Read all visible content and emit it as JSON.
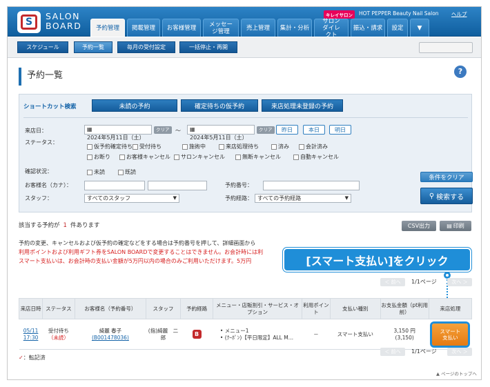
{
  "header": {
    "brand_line1": "SALON",
    "brand_line2": "BOARD",
    "logo_letter": "S",
    "kirei_badge": "キレイサロン",
    "salon_name": "HOT PEPPER Beauty Nail Salon",
    "help_link": "ヘルプ"
  },
  "nav": [
    "予約管理",
    "掲載管理",
    "お客様管理",
    "メッセージ管理",
    "売上管理",
    "集計・分析",
    "サロンダイレクト",
    "振込・請求",
    "設定"
  ],
  "subnav": [
    "スケジュール",
    "予約一覧",
    "毎月の受付設定",
    "一括停止・再開"
  ],
  "page_title": "予約一覧",
  "help_icon": "?",
  "shortcut": {
    "label": "ショートカット検索",
    "buttons": [
      "未読の予約",
      "確定待ちの仮予約",
      "来店処理未登録の予約"
    ]
  },
  "form": {
    "visit_date_label": "来店日：",
    "date_from": "2024年5月11日（土）",
    "date_to": "2024年5月11日（土）",
    "clear": "クリア",
    "tilde": "〜",
    "day_buttons": [
      "昨日",
      "本日",
      "明日"
    ],
    "status_label": "ステータス：",
    "statuses": [
      "仮予約確定待ち",
      "受付待ち",
      "施術中",
      "来店処理待ち",
      "済み",
      "会計済み",
      "お断り",
      "お客様キャンセル",
      "サロンキャンセル",
      "無断キャンセル",
      "自動キャンセル"
    ],
    "confirm_label": "確認状況：",
    "confirm_options": [
      "未読",
      "既読"
    ],
    "customer_label": "お客様名（カナ）：",
    "reservation_no_label": "予約番号：",
    "staff_label": "スタッフ：",
    "staff_value": "すべてのスタッフ",
    "route_label": "予約経路：",
    "route_value": "すべての予約経路",
    "clear_conditions": "条件をクリア",
    "search_button": "検索する"
  },
  "result": {
    "prefix": "該当する予約が",
    "count": "1",
    "suffix": "件あります",
    "csv": "CSV出力",
    "print": "印刷"
  },
  "notes": {
    "line1": "予約の変更、キャンセルおよび仮予約の確定などをする場合は予約番号を押して、詳細画面から",
    "line2": "利用ポイントおよび利用ギフト券をSALON BOARDで変更することはできません。お会計時には利",
    "line3": "スマート支払いは、お会計時の支払い金額が5万円以内の場合のみご利用いただけます。5万円"
  },
  "callout": "[スマート支払い]をクリック",
  "pager": {
    "prev": "＜ 前へ",
    "next": "次へ ＞",
    "page": "1/1ページ"
  },
  "table": {
    "headers": [
      "来店日時",
      "ステータス",
      "お客様名（予約番号）",
      "スタッフ",
      "予約経路",
      "メニュー・店販割引・サービス・オプション",
      "利用ポイント",
      "支払い種別",
      "お支払金額（pt利用前）",
      "来店処理"
    ],
    "row": {
      "date": "05/11",
      "time": "17:30",
      "status1": "受付待ち",
      "status2": "（未読）",
      "name": "綺麗 春子",
      "number": "(B001478036)",
      "staff": "(指)綺麗　二郎",
      "route_badge": "B",
      "menu1": "メニュー1",
      "menu2": "(ｸｰﾎﾟﾝ)【平日限定】ALL M…",
      "points": "－",
      "payment_type": "スマート支払い",
      "amount": "3,150 円",
      "amount_pt": "(3,150)",
      "action": "スマート支払い"
    }
  },
  "legend": {
    "mark": "✓",
    "text": "：転記済"
  },
  "page_top": "▲ ページのトップへ"
}
